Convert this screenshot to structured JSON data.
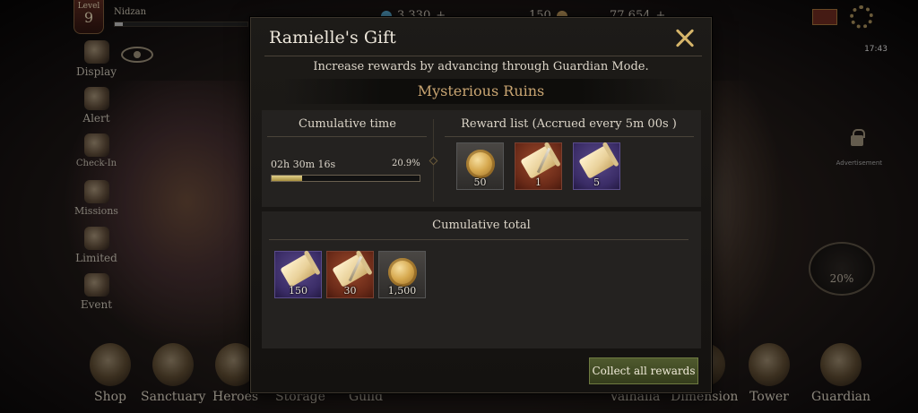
{
  "hud": {
    "level_label": "Level",
    "level_value": "9",
    "player_name": "Nidzan",
    "currencies": [
      {
        "value": "3,330",
        "color": "#5ab0d8"
      },
      {
        "value": "150",
        "color": "#c8a060"
      },
      {
        "value": "77,654",
        "color": "#d9b25a"
      }
    ],
    "status_time": "17:43",
    "right_lock_label": "Advertisement",
    "right_progress": "20%",
    "left_menu": [
      "Display",
      "Alert",
      "Check-In",
      "Missions",
      "Limited",
      "Event"
    ],
    "bottom_menu": [
      "Shop",
      "Sanctuary",
      "Heroes",
      "Storage",
      "Guild",
      "Valhalla",
      "Dimension",
      "Tower",
      "Guardian"
    ]
  },
  "modal": {
    "title": "Ramielle's Gift",
    "subtitle": "Increase rewards by advancing through Guardian Mode.",
    "stage_name": "Mysterious Ruins",
    "cumulative_time": {
      "title": "Cumulative time",
      "value": "02h 30m 16s",
      "percent_text": "20.9%",
      "progress": 0.209
    },
    "reward_list": {
      "title": "Reward list (Accrued every 5m 00s )",
      "items": [
        {
          "icon": "gold-coin-icon",
          "tier": "common",
          "qty": "50"
        },
        {
          "icon": "scroll-quill-icon",
          "tier": "rare",
          "qty": "1"
        },
        {
          "icon": "scroll-icon",
          "tier": "epic",
          "qty": "5"
        }
      ]
    },
    "cumulative_total": {
      "title": "Cumulative total",
      "items": [
        {
          "icon": "scroll-icon",
          "tier": "epic",
          "qty": "150"
        },
        {
          "icon": "scroll-quill-icon",
          "tier": "rare",
          "qty": "30"
        },
        {
          "icon": "gold-coin-icon",
          "tier": "common",
          "qty": "1,500"
        }
      ]
    },
    "collect_label": "Collect all rewards"
  }
}
